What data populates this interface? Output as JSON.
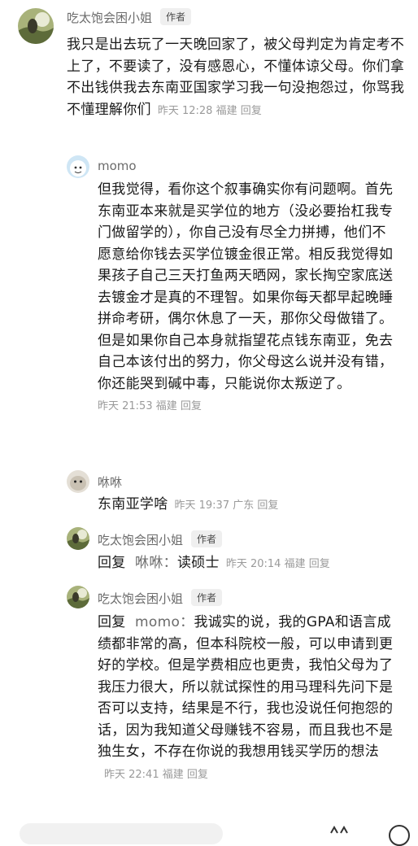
{
  "comments": [
    {
      "user": "吃太饱会困小姐",
      "badge": "作者",
      "text": "我只是出去玩了一天晚回家了，被父母判定为肯定考不上了，不要读了，没有感恩心，不懂体谅父母。你们拿不出钱供我去东南亚国家学习我一句没抱怨过，你骂我不懂理解你们",
      "time": "昨天 12:28",
      "location": "福建",
      "reply_label": "回复"
    },
    {
      "user": "momo",
      "text": "但我觉得，看你这个叙事确实你有问题啊。首先东南亚本来就是买学位的地方（没必要抬杠我专门做留学的），你自己没有尽全力拼搏，他们不愿意给你钱去买学位镀金很正常。相反我觉得如果孩子自己三天打鱼两天晒网，家长掏空家底送去镀金才是真的不理智。如果你每天都早起晚睡拼命考研，偶尔休息了一天，那你父母做错了。但是如果你自己本身就指望花点钱东南亚，免去自己本该付出的努力，你父母这么说并没有错，你还能哭到碱中毒，只能说你太叛逆了。",
      "time": "昨天 21:53",
      "location": "福建",
      "reply_label": "回复"
    },
    {
      "user": "咻咻",
      "text": "东南亚学啥",
      "time": "昨天 19:37",
      "location": "广东",
      "reply_label": "回复"
    },
    {
      "user": "吃太饱会困小姐",
      "badge": "作者",
      "reply_prefix": "回复",
      "reply_target": "咻咻：",
      "text": "读硕士",
      "time": "昨天 20:14",
      "location": "福建",
      "reply_label": "回复"
    },
    {
      "user": "吃太饱会困小姐",
      "badge": "作者",
      "reply_prefix": "回复",
      "reply_target": "momo：",
      "text": "我诚实的说，我的GPA和语言成绩都非常的高，但本科院校一般，可以申请到更好的学校。但是学费相应也更贵，我怕父母为了我压力很大，所以就试探性的用马理科先问下是否可以支持，结果是不行，我也没说任何抱怨的话，因为我知道父母赚钱不容易，而且我也不是独生女，不存在你说的我想用钱买学历的想法",
      "time": "昨天 22:41",
      "location": "福建",
      "reply_label": "回复"
    }
  ],
  "colors": {
    "name": "#6b6b6b",
    "meta": "#9a9a9a",
    "text": "#1a1a1a",
    "badge_bg": "#efefef"
  }
}
